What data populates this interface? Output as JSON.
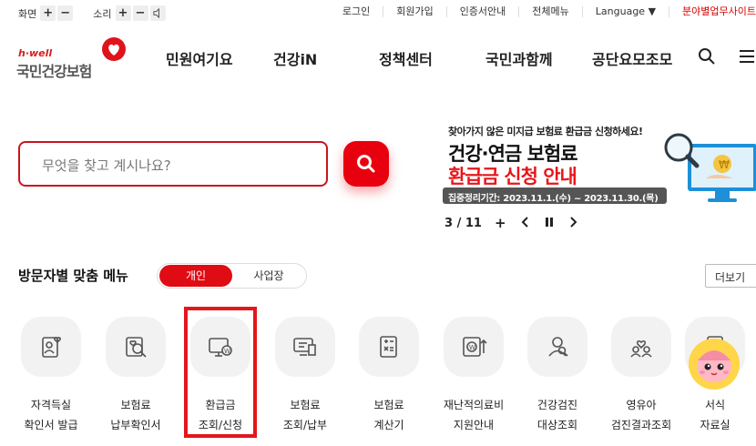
{
  "utility": {
    "screen_label": "화면",
    "sound_label": "소리",
    "plus": "+",
    "minus": "−",
    "links": [
      "로그인",
      "회원가입",
      "인증서안내",
      "전체메뉴",
      "Language ▼",
      "분야별업무사이트"
    ]
  },
  "logo": {
    "tagline": "h·well",
    "name": "국민건강보험"
  },
  "gnb": [
    "민원여기요",
    "건강iN",
    "정책센터",
    "국민과함께",
    "공단요모조모"
  ],
  "search": {
    "placeholder": "무엇을 찾고 계시나요?"
  },
  "banner": {
    "top_text": "찾아가지 않은 미지급 보험료 환급금 신청하세요!",
    "line1": "건강·연금 보험료",
    "line2": "환급금 신청 안내",
    "period": "집중정리기간: 2023.11.1.(수) ~ 2023.11.30.(목)",
    "page": "3 / 11",
    "add": "+"
  },
  "visitor_menu": {
    "title": "방문자별 맞춤 메뉴",
    "tab_personal": "개인",
    "tab_business": "사업장",
    "more": "더보기",
    "items": [
      {
        "l1": "자격득실",
        "l2": "확인서 발급",
        "icon": "person-heart-icon"
      },
      {
        "l1": "보험료",
        "l2": "납부확인서",
        "icon": "document-search-icon"
      },
      {
        "l1": "환급금",
        "l2": "조회/신청",
        "icon": "monitor-won-icon"
      },
      {
        "l1": "보험료",
        "l2": "조회/납부",
        "icon": "monitor-receipt-icon"
      },
      {
        "l1": "보험료",
        "l2": "계산기",
        "icon": "calculator-icon"
      },
      {
        "l1": "재난적의료비",
        "l2": "지원안내",
        "icon": "won-arrow-icon"
      },
      {
        "l1": "건강검진",
        "l2": "대상조회",
        "icon": "people-search-icon"
      },
      {
        "l1": "영유아",
        "l2": "검진결과조회",
        "icon": "family-heart-icon"
      },
      {
        "l1": "서식",
        "l2": "자료실",
        "icon": "document-icon"
      }
    ]
  },
  "colors": {
    "brand_red": "#e00c14",
    "banner_red": "#e8161b",
    "highlight_box": "#e4161c"
  }
}
